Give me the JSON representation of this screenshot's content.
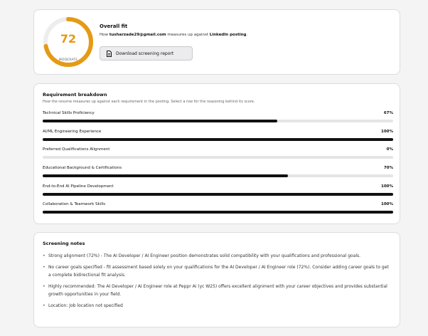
{
  "overall": {
    "score": "72",
    "score_value": 72,
    "score_max": 100,
    "rating": "MODERATE",
    "title": "Overall fit",
    "subtitle_prefix": "How ",
    "email": "tusharzade29@gmail.com",
    "subtitle_middle": " measures up against ",
    "source": "LinkedIn posting",
    "subtitle_suffix": ".",
    "download_label": "Download screening report",
    "download_icon": "document-icon",
    "accent_color": "#e59a14",
    "track_color": "#ededed"
  },
  "breakdown": {
    "title": "Requirement breakdown",
    "subtitle": "How the resume measures up against each requirement in the posting. Select a row for the reasoning behind its score.",
    "bar_color": "#111111",
    "track_color": "#e4e4e6",
    "items": [
      {
        "label": "Technical Skills Proficiency",
        "percent_text": "67%",
        "value": 67
      },
      {
        "label": "AI/ML Engineering Experience",
        "percent_text": "100%",
        "value": 100
      },
      {
        "label": "Preferred Qualifications Alignment",
        "percent_text": "0%",
        "value": 0
      },
      {
        "label": "Educational Background & Certifications",
        "percent_text": "70%",
        "value": 70
      },
      {
        "label": "End-to-End AI Pipeline Development",
        "percent_text": "100%",
        "value": 100
      },
      {
        "label": "Collaboration & Teamwork Skills",
        "percent_text": "100%",
        "value": 100
      }
    ]
  },
  "notes": {
    "title": "Screening notes",
    "items": [
      "Strong alignment (72%) - The AI Developer / AI Engineer position demonstrates solid compatibility with your qualifications and professional goals.",
      "No career goals specified - fit assessment based solely on your qualifications for the AI Developer / AI Engineer role (72%). Consider adding career goals to get a complete bidirectional fit analysis.",
      "Highly recommended: The AI Developer / AI Engineer role at Peppr Ai (yc W25) offers excellent alignment with your career objectives and provides substantial growth opportunities in your field.",
      "Location: Job location not specified"
    ]
  }
}
